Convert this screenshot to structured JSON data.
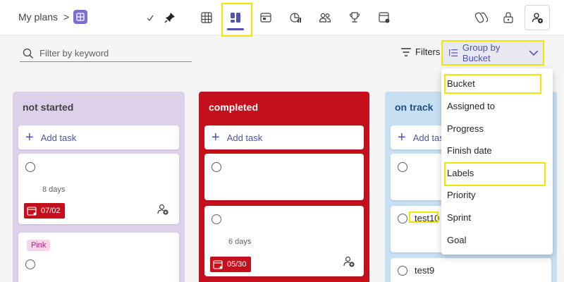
{
  "breadcrumb": {
    "root": "My plans",
    "separator": ">"
  },
  "toolbar": {
    "views": [
      "list-view",
      "board-view",
      "schedule-view",
      "charts-view",
      "people-view",
      "goals-view",
      "timeline-view"
    ],
    "active_view": "board-view"
  },
  "filters": {
    "search_placeholder": "Filter by keyword",
    "filters_label": "Filters",
    "group_by_label": "Group by Bucket"
  },
  "group_menu": {
    "items": [
      "Bucket",
      "Assigned to",
      "Progress",
      "Finish date",
      "Labels",
      "Priority",
      "Sprint",
      "Goal"
    ],
    "highlighted": [
      "Bucket",
      "Labels"
    ]
  },
  "buckets": [
    {
      "title": "not started",
      "add_task": "Add task",
      "cards": [
        {
          "title": "",
          "days": "8 days",
          "due": "07/02"
        },
        {
          "label": "Pink"
        }
      ]
    },
    {
      "title": "completed",
      "add_task": "Add task",
      "cards": [
        {
          "title": ""
        },
        {
          "days": "6 days",
          "due": "05/30"
        }
      ]
    },
    {
      "title": "on track",
      "add_task": "Add task",
      "cards": [
        {
          "title": ""
        },
        {
          "title": "test10"
        },
        {
          "title": "test9"
        }
      ]
    }
  ],
  "colors": {
    "accent": "#4f52b2",
    "highlight": "#f2e600",
    "due_red": "#c4101d",
    "not_started_bg": "#ddd1ea",
    "completed_bg": "#c4101d",
    "on_track_bg": "#c7dff2"
  }
}
